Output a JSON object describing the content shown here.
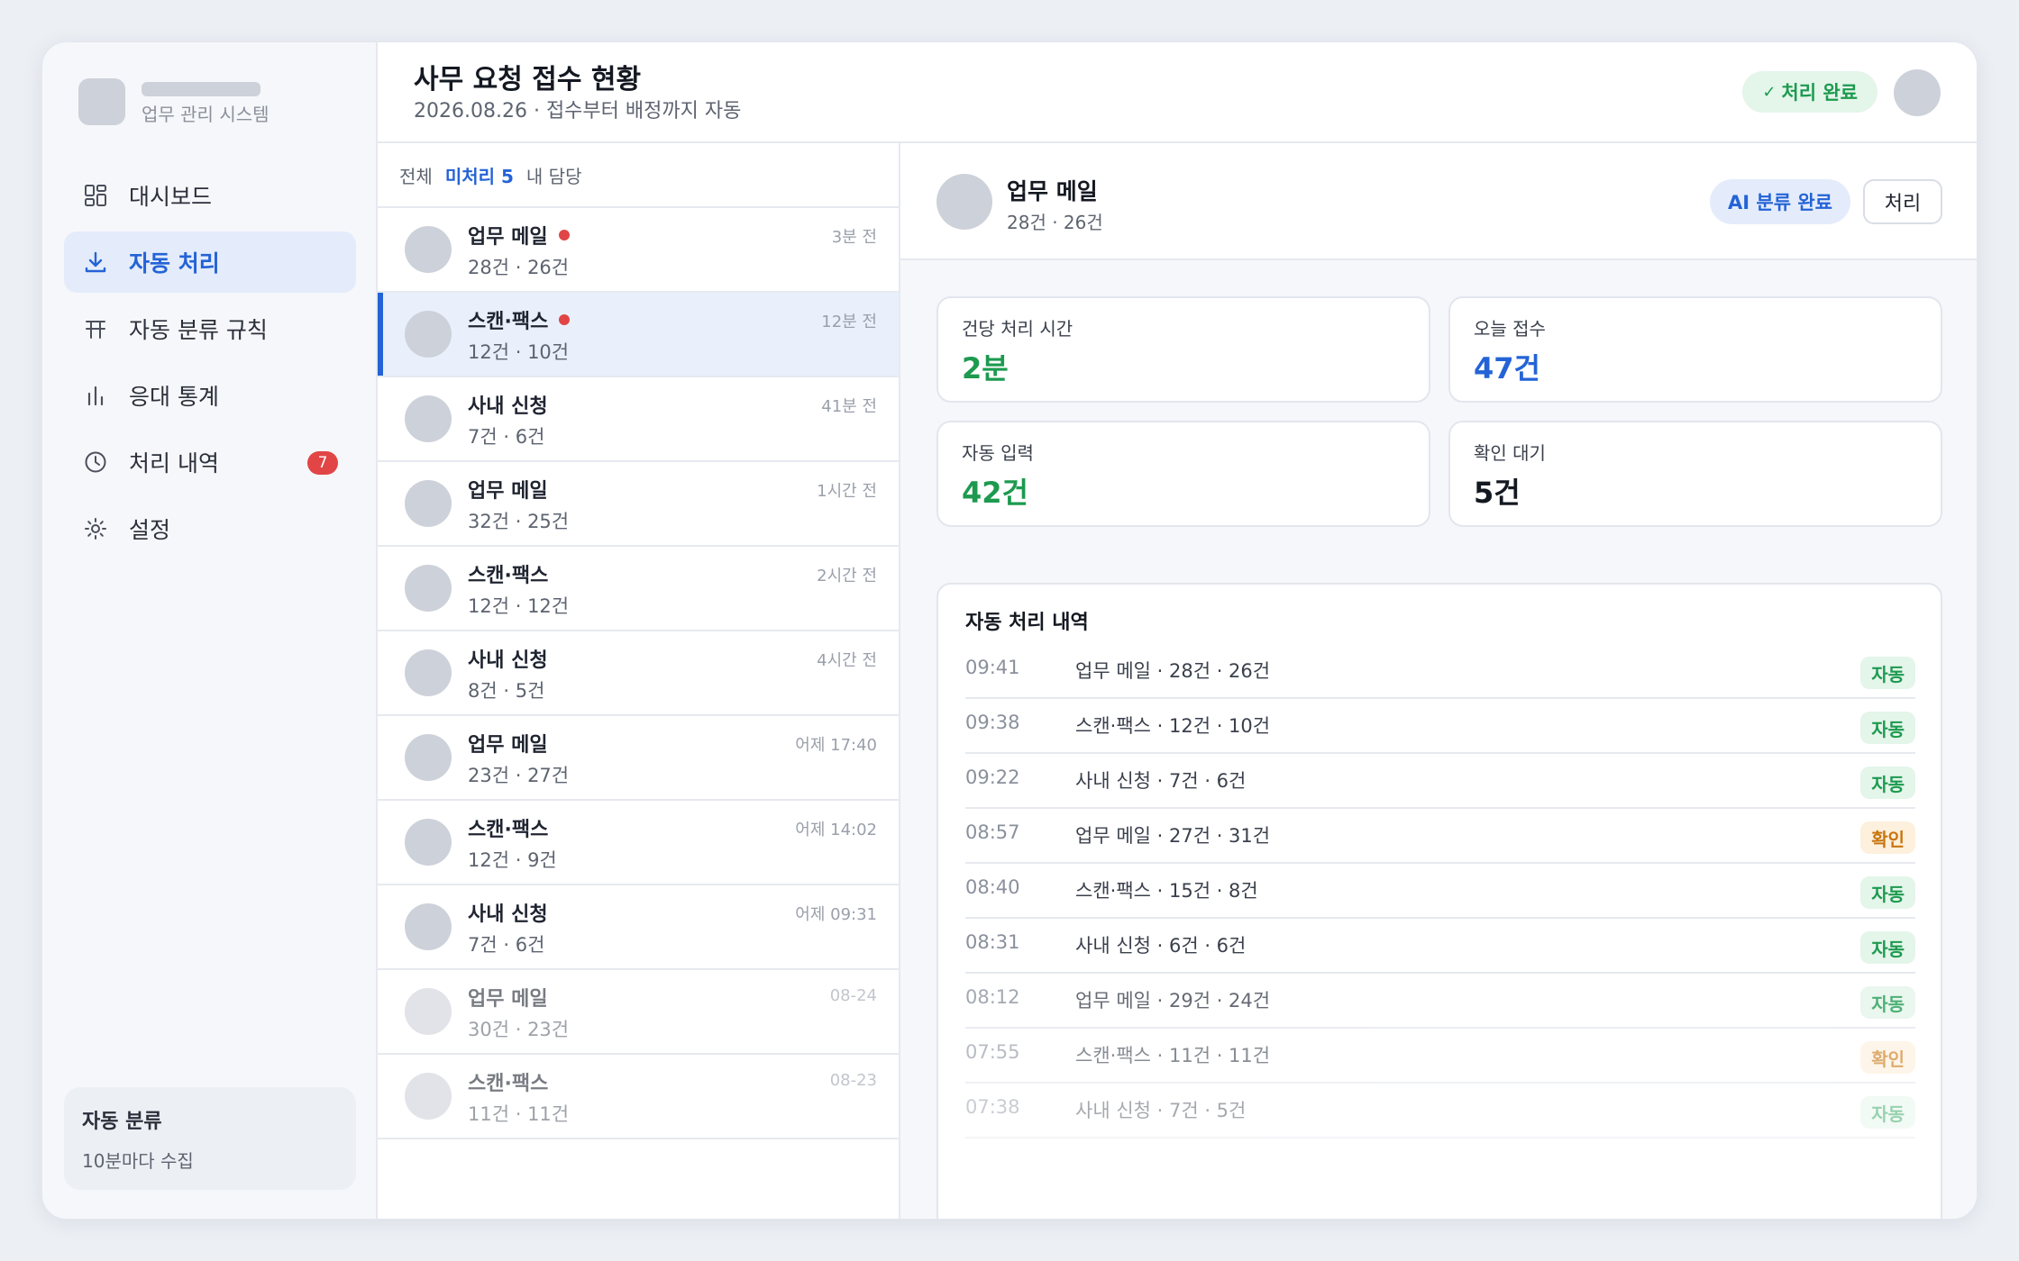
{
  "sidebar": {
    "brand_sub": "업무 관리 시스템",
    "items": [
      {
        "label": "대시보드",
        "icon": "dashboard-icon"
      },
      {
        "label": "자동 처리",
        "icon": "download-icon"
      },
      {
        "label": "자동 분류 규칙",
        "icon": "rules-icon"
      },
      {
        "label": "응대 통계",
        "icon": "bar-chart-icon"
      },
      {
        "label": "처리 내역",
        "icon": "clock-icon",
        "badge": "7"
      },
      {
        "label": "설정",
        "icon": "gear-icon"
      }
    ],
    "footer": {
      "title": "자동 분류",
      "sub": "10분마다 수집"
    }
  },
  "header": {
    "title": "사무 요청 접수 현황",
    "subtitle": "2026.08.26 · 접수부터 배정까지 자동",
    "status": "처리 완료",
    "status_icon": "check-icon"
  },
  "list": {
    "filters": [
      {
        "label": "전체"
      },
      {
        "label": "미처리 5"
      },
      {
        "label": "내 담당"
      }
    ],
    "rows": [
      {
        "title": "업무 메일",
        "sub": "28건 · 26건",
        "time": "3분 전"
      },
      {
        "title": "스캔·팩스",
        "sub": "12건 · 10건",
        "time": "12분 전"
      },
      {
        "title": "사내 신청",
        "sub": "7건 · 6건",
        "time": "41분 전"
      },
      {
        "title": "업무 메일",
        "sub": "32건 · 25건",
        "time": "1시간 전"
      },
      {
        "title": "스캔·팩스",
        "sub": "12건 · 12건",
        "time": "2시간 전"
      },
      {
        "title": "사내 신청",
        "sub": "8건 · 5건",
        "time": "4시간 전"
      },
      {
        "title": "업무 메일",
        "sub": "23건 · 27건",
        "time": "어제 17:40"
      },
      {
        "title": "스캔·팩스",
        "sub": "12건 · 9건",
        "time": "어제 14:02"
      },
      {
        "title": "사내 신청",
        "sub": "7건 · 6건",
        "time": "어제 09:31"
      },
      {
        "title": "업무 메일",
        "sub": "30건 · 23건",
        "time": "08-24"
      },
      {
        "title": "스캔·팩스",
        "sub": "11건 · 11건",
        "time": "08-23"
      }
    ]
  },
  "detail": {
    "title": "업무 메일",
    "sub": "28건 · 26건",
    "ai_status": "AI 분류 완료",
    "action": "처리",
    "stats": [
      {
        "label": "건당 처리 시간",
        "value": "2분",
        "color": "#1d9a4f"
      },
      {
        "label": "오늘 접수",
        "value": "47건",
        "color": "#2463d6"
      },
      {
        "label": "자동 입력",
        "value": "42건",
        "color": "#1d9a4f"
      },
      {
        "label": "확인 대기",
        "value": "5건",
        "color": "#141821"
      }
    ],
    "log_title": "자동 처리 내역",
    "log": [
      {
        "time": "09:41",
        "desc": "업무 메일 · 28건 · 26건",
        "tag": "자동"
      },
      {
        "time": "09:38",
        "desc": "스캔·팩스 · 12건 · 10건",
        "tag": "자동"
      },
      {
        "time": "09:22",
        "desc": "사내 신청 · 7건 · 6건",
        "tag": "자동"
      },
      {
        "time": "08:57",
        "desc": "업무 메일 · 27건 · 31건",
        "tag": "확인"
      },
      {
        "time": "08:40",
        "desc": "스캔·팩스 · 15건 · 8건",
        "tag": "자동"
      },
      {
        "time": "08:31",
        "desc": "사내 신청 · 6건 · 6건",
        "tag": "자동"
      },
      {
        "time": "08:12",
        "desc": "업무 메일 · 29건 · 24건",
        "tag": "자동"
      },
      {
        "time": "07:55",
        "desc": "스캔·팩스 · 11건 · 11건",
        "tag": "확인"
      },
      {
        "time": "07:38",
        "desc": "사내 신청 · 7건 · 5건",
        "tag": "자동"
      }
    ]
  },
  "colors": {
    "accent": "#2463d6",
    "success": "#1d9a4f",
    "warning": "#c9750f",
    "danger": "#e14545"
  }
}
